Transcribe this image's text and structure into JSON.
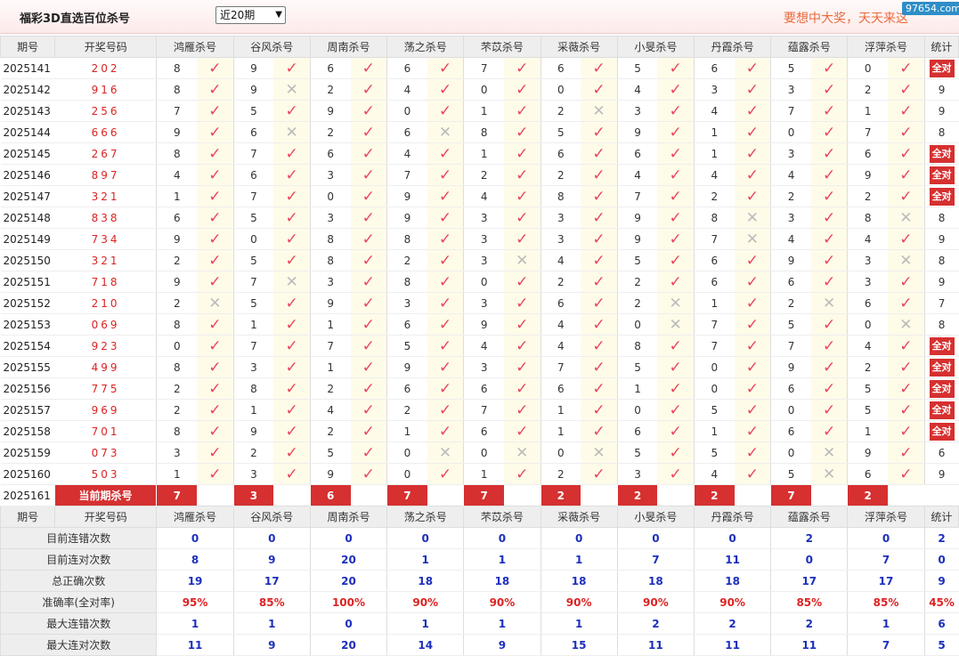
{
  "header": {
    "title": "福彩3D直选百位杀号",
    "range_select": "近20期",
    "slogan": "要想中大奖，天天来这",
    "watermark": "97654.com"
  },
  "columns": {
    "period": "期号",
    "lottery": "开奖号码",
    "experts": [
      "鸿雁杀号",
      "谷风杀号",
      "周南杀号",
      "荡之杀号",
      "芣苡杀号",
      "采薇杀号",
      "小旻杀号",
      "丹霞杀号",
      "蕴露杀号",
      "浮萍杀号"
    ],
    "stat": "统计"
  },
  "rows": [
    {
      "period": "2025141",
      "lottery": "202",
      "kills": [
        [
          "8",
          "ok"
        ],
        [
          "9",
          "ok"
        ],
        [
          "6",
          "ok"
        ],
        [
          "6",
          "ok"
        ],
        [
          "7",
          "ok"
        ],
        [
          "6",
          "ok"
        ],
        [
          "5",
          "ok"
        ],
        [
          "6",
          "ok"
        ],
        [
          "5",
          "ok"
        ],
        [
          "0",
          "ok"
        ]
      ],
      "stat": "全对"
    },
    {
      "period": "2025142",
      "lottery": "916",
      "kills": [
        [
          "8",
          "ok"
        ],
        [
          "9",
          "no"
        ],
        [
          "2",
          "ok"
        ],
        [
          "4",
          "ok"
        ],
        [
          "0",
          "ok"
        ],
        [
          "0",
          "ok"
        ],
        [
          "4",
          "ok"
        ],
        [
          "3",
          "ok"
        ],
        [
          "3",
          "ok"
        ],
        [
          "2",
          "ok"
        ]
      ],
      "stat": "9"
    },
    {
      "period": "2025143",
      "lottery": "256",
      "kills": [
        [
          "7",
          "ok"
        ],
        [
          "5",
          "ok"
        ],
        [
          "9",
          "ok"
        ],
        [
          "0",
          "ok"
        ],
        [
          "1",
          "ok"
        ],
        [
          "2",
          "no"
        ],
        [
          "3",
          "ok"
        ],
        [
          "4",
          "ok"
        ],
        [
          "7",
          "ok"
        ],
        [
          "1",
          "ok"
        ]
      ],
      "stat": "9"
    },
    {
      "period": "2025144",
      "lottery": "666",
      "kills": [
        [
          "9",
          "ok"
        ],
        [
          "6",
          "no"
        ],
        [
          "2",
          "ok"
        ],
        [
          "6",
          "no"
        ],
        [
          "8",
          "ok"
        ],
        [
          "5",
          "ok"
        ],
        [
          "9",
          "ok"
        ],
        [
          "1",
          "ok"
        ],
        [
          "0",
          "ok"
        ],
        [
          "7",
          "ok"
        ]
      ],
      "stat": "8"
    },
    {
      "period": "2025145",
      "lottery": "267",
      "kills": [
        [
          "8",
          "ok"
        ],
        [
          "7",
          "ok"
        ],
        [
          "6",
          "ok"
        ],
        [
          "4",
          "ok"
        ],
        [
          "1",
          "ok"
        ],
        [
          "6",
          "ok"
        ],
        [
          "6",
          "ok"
        ],
        [
          "1",
          "ok"
        ],
        [
          "3",
          "ok"
        ],
        [
          "6",
          "ok"
        ]
      ],
      "stat": "全对"
    },
    {
      "period": "2025146",
      "lottery": "897",
      "kills": [
        [
          "4",
          "ok"
        ],
        [
          "6",
          "ok"
        ],
        [
          "3",
          "ok"
        ],
        [
          "7",
          "ok"
        ],
        [
          "2",
          "ok"
        ],
        [
          "2",
          "ok"
        ],
        [
          "4",
          "ok"
        ],
        [
          "4",
          "ok"
        ],
        [
          "4",
          "ok"
        ],
        [
          "9",
          "ok"
        ]
      ],
      "stat": "全对"
    },
    {
      "period": "2025147",
      "lottery": "321",
      "kills": [
        [
          "1",
          "ok"
        ],
        [
          "7",
          "ok"
        ],
        [
          "0",
          "ok"
        ],
        [
          "9",
          "ok"
        ],
        [
          "4",
          "ok"
        ],
        [
          "8",
          "ok"
        ],
        [
          "7",
          "ok"
        ],
        [
          "2",
          "ok"
        ],
        [
          "2",
          "ok"
        ],
        [
          "2",
          "ok"
        ]
      ],
      "stat": "全对"
    },
    {
      "period": "2025148",
      "lottery": "838",
      "kills": [
        [
          "6",
          "ok"
        ],
        [
          "5",
          "ok"
        ],
        [
          "3",
          "ok"
        ],
        [
          "9",
          "ok"
        ],
        [
          "3",
          "ok"
        ],
        [
          "3",
          "ok"
        ],
        [
          "9",
          "ok"
        ],
        [
          "8",
          "no"
        ],
        [
          "3",
          "ok"
        ],
        [
          "8",
          "no"
        ]
      ],
      "stat": "8"
    },
    {
      "period": "2025149",
      "lottery": "734",
      "kills": [
        [
          "9",
          "ok"
        ],
        [
          "0",
          "ok"
        ],
        [
          "8",
          "ok"
        ],
        [
          "8",
          "ok"
        ],
        [
          "3",
          "ok"
        ],
        [
          "3",
          "ok"
        ],
        [
          "9",
          "ok"
        ],
        [
          "7",
          "no"
        ],
        [
          "4",
          "ok"
        ],
        [
          "4",
          "ok"
        ]
      ],
      "stat": "9"
    },
    {
      "period": "2025150",
      "lottery": "321",
      "kills": [
        [
          "2",
          "ok"
        ],
        [
          "5",
          "ok"
        ],
        [
          "8",
          "ok"
        ],
        [
          "2",
          "ok"
        ],
        [
          "3",
          "no"
        ],
        [
          "4",
          "ok"
        ],
        [
          "5",
          "ok"
        ],
        [
          "6",
          "ok"
        ],
        [
          "9",
          "ok"
        ],
        [
          "3",
          "no"
        ]
      ],
      "stat": "8"
    },
    {
      "period": "2025151",
      "lottery": "718",
      "kills": [
        [
          "9",
          "ok"
        ],
        [
          "7",
          "no"
        ],
        [
          "3",
          "ok"
        ],
        [
          "8",
          "ok"
        ],
        [
          "0",
          "ok"
        ],
        [
          "2",
          "ok"
        ],
        [
          "2",
          "ok"
        ],
        [
          "6",
          "ok"
        ],
        [
          "6",
          "ok"
        ],
        [
          "3",
          "ok"
        ]
      ],
      "stat": "9"
    },
    {
      "period": "2025152",
      "lottery": "210",
      "kills": [
        [
          "2",
          "no"
        ],
        [
          "5",
          "ok"
        ],
        [
          "9",
          "ok"
        ],
        [
          "3",
          "ok"
        ],
        [
          "3",
          "ok"
        ],
        [
          "6",
          "ok"
        ],
        [
          "2",
          "no"
        ],
        [
          "1",
          "ok"
        ],
        [
          "2",
          "no"
        ],
        [
          "6",
          "ok"
        ]
      ],
      "stat": "7"
    },
    {
      "period": "2025153",
      "lottery": "069",
      "kills": [
        [
          "8",
          "ok"
        ],
        [
          "1",
          "ok"
        ],
        [
          "1",
          "ok"
        ],
        [
          "6",
          "ok"
        ],
        [
          "9",
          "ok"
        ],
        [
          "4",
          "ok"
        ],
        [
          "0",
          "no"
        ],
        [
          "7",
          "ok"
        ],
        [
          "5",
          "ok"
        ],
        [
          "0",
          "no"
        ]
      ],
      "stat": "8"
    },
    {
      "period": "2025154",
      "lottery": "923",
      "kills": [
        [
          "0",
          "ok"
        ],
        [
          "7",
          "ok"
        ],
        [
          "7",
          "ok"
        ],
        [
          "5",
          "ok"
        ],
        [
          "4",
          "ok"
        ],
        [
          "4",
          "ok"
        ],
        [
          "8",
          "ok"
        ],
        [
          "7",
          "ok"
        ],
        [
          "7",
          "ok"
        ],
        [
          "4",
          "ok"
        ]
      ],
      "stat": "全对"
    },
    {
      "period": "2025155",
      "lottery": "499",
      "kills": [
        [
          "8",
          "ok"
        ],
        [
          "3",
          "ok"
        ],
        [
          "1",
          "ok"
        ],
        [
          "9",
          "ok"
        ],
        [
          "3",
          "ok"
        ],
        [
          "7",
          "ok"
        ],
        [
          "5",
          "ok"
        ],
        [
          "0",
          "ok"
        ],
        [
          "9",
          "ok"
        ],
        [
          "2",
          "ok"
        ]
      ],
      "stat": "全对"
    },
    {
      "period": "2025156",
      "lottery": "775",
      "kills": [
        [
          "2",
          "ok"
        ],
        [
          "8",
          "ok"
        ],
        [
          "2",
          "ok"
        ],
        [
          "6",
          "ok"
        ],
        [
          "6",
          "ok"
        ],
        [
          "6",
          "ok"
        ],
        [
          "1",
          "ok"
        ],
        [
          "0",
          "ok"
        ],
        [
          "6",
          "ok"
        ],
        [
          "5",
          "ok"
        ]
      ],
      "stat": "全对"
    },
    {
      "period": "2025157",
      "lottery": "969",
      "kills": [
        [
          "2",
          "ok"
        ],
        [
          "1",
          "ok"
        ],
        [
          "4",
          "ok"
        ],
        [
          "2",
          "ok"
        ],
        [
          "7",
          "ok"
        ],
        [
          "1",
          "ok"
        ],
        [
          "0",
          "ok"
        ],
        [
          "5",
          "ok"
        ],
        [
          "0",
          "ok"
        ],
        [
          "5",
          "ok"
        ]
      ],
      "stat": "全对"
    },
    {
      "period": "2025158",
      "lottery": "701",
      "kills": [
        [
          "8",
          "ok"
        ],
        [
          "9",
          "ok"
        ],
        [
          "2",
          "ok"
        ],
        [
          "1",
          "ok"
        ],
        [
          "6",
          "ok"
        ],
        [
          "1",
          "ok"
        ],
        [
          "6",
          "ok"
        ],
        [
          "1",
          "ok"
        ],
        [
          "6",
          "ok"
        ],
        [
          "1",
          "ok"
        ]
      ],
      "stat": "全对"
    },
    {
      "period": "2025159",
      "lottery": "073",
      "kills": [
        [
          "3",
          "ok"
        ],
        [
          "2",
          "ok"
        ],
        [
          "5",
          "ok"
        ],
        [
          "0",
          "no"
        ],
        [
          "0",
          "no"
        ],
        [
          "0",
          "no"
        ],
        [
          "5",
          "ok"
        ],
        [
          "5",
          "ok"
        ],
        [
          "0",
          "no"
        ],
        [
          "9",
          "ok"
        ]
      ],
      "stat": "6"
    },
    {
      "period": "2025160",
      "lottery": "503",
      "kills": [
        [
          "1",
          "ok"
        ],
        [
          "3",
          "ok"
        ],
        [
          "9",
          "ok"
        ],
        [
          "0",
          "ok"
        ],
        [
          "1",
          "ok"
        ],
        [
          "2",
          "ok"
        ],
        [
          "3",
          "ok"
        ],
        [
          "4",
          "ok"
        ],
        [
          "5",
          "no"
        ],
        [
          "6",
          "ok"
        ]
      ],
      "stat": "9"
    }
  ],
  "current": {
    "period": "2025161",
    "label": "当前期杀号",
    "kills": [
      "7",
      "3",
      "6",
      "7",
      "7",
      "2",
      "2",
      "2",
      "7",
      "2"
    ]
  },
  "summary": [
    {
      "label": "目前连错次数",
      "values": [
        "0",
        "0",
        "0",
        "0",
        "0",
        "0",
        "0",
        "0",
        "2",
        "0"
      ],
      "total": "2",
      "red": false
    },
    {
      "label": "目前连对次数",
      "values": [
        "8",
        "9",
        "20",
        "1",
        "1",
        "1",
        "7",
        "11",
        "0",
        "7"
      ],
      "total": "0",
      "red": false
    },
    {
      "label": "总正确次数",
      "values": [
        "19",
        "17",
        "20",
        "18",
        "18",
        "18",
        "18",
        "18",
        "17",
        "17"
      ],
      "total": "9",
      "red": false
    },
    {
      "label": "准确率(全对率)",
      "values": [
        "95%",
        "85%",
        "100%",
        "90%",
        "90%",
        "90%",
        "90%",
        "90%",
        "85%",
        "85%"
      ],
      "total": "45%",
      "red": true
    },
    {
      "label": "最大连错次数",
      "values": [
        "1",
        "1",
        "0",
        "1",
        "1",
        "1",
        "2",
        "2",
        "2",
        "1"
      ],
      "total": "6",
      "red": false
    },
    {
      "label": "最大连对次数",
      "values": [
        "11",
        "9",
        "20",
        "14",
        "9",
        "15",
        "11",
        "11",
        "11",
        "7"
      ],
      "total": "5",
      "red": false
    }
  ],
  "icons": {
    "ok": "check-icon",
    "no": "cross-icon"
  },
  "colors": {
    "accent": "#d63030",
    "check": "#e8465a",
    "cross": "#bbbbbb",
    "summary_value": "#1c2fbd"
  }
}
